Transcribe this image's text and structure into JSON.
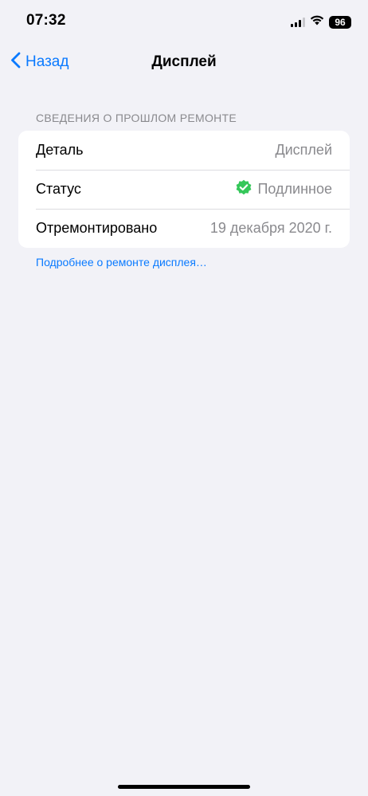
{
  "status_bar": {
    "time": "07:32",
    "battery_level": "96",
    "signal_bars_active": 3,
    "signal_bars_total": 4,
    "icons": [
      "cellular-signal-icon",
      "wifi-icon",
      "battery-icon"
    ]
  },
  "nav": {
    "back_label": "Назад",
    "title": "Дисплей"
  },
  "section": {
    "header": "СВЕДЕНИЯ О ПРОШЛОМ РЕМОНТЕ",
    "rows": [
      {
        "label": "Деталь",
        "value": "Дисплей"
      },
      {
        "label": "Статус",
        "value": "Подлинное",
        "icon": "verified-check-icon"
      },
      {
        "label": "Отремонтировано",
        "value": "19 декабря 2020 г."
      }
    ],
    "footer_link": "Подробнее о ремонте дисплея…"
  },
  "colors": {
    "accent": "#0a7aff",
    "background": "#f2f2f7",
    "secondary_text": "#8a8a8e",
    "verified_green": "#34c759"
  }
}
